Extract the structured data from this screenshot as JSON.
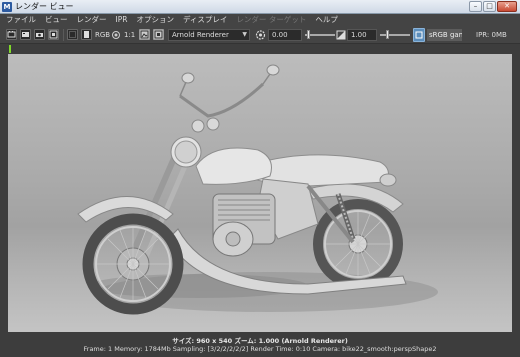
{
  "window": {
    "icon_letter": "M",
    "title": "レンダー ビュー",
    "buttons": {
      "minimize": "–",
      "maximize": "□",
      "close": "✕"
    }
  },
  "menu": [
    {
      "label": "ファイル",
      "enabled": true
    },
    {
      "label": "ビュー",
      "enabled": true
    },
    {
      "label": "レンダー",
      "enabled": true
    },
    {
      "label": "IPR",
      "enabled": true
    },
    {
      "label": "オプション",
      "enabled": true
    },
    {
      "label": "ディスプレイ",
      "enabled": true
    },
    {
      "label": "レンダー ターゲット",
      "enabled": false
    },
    {
      "label": "ヘルプ",
      "enabled": true
    }
  ],
  "toolbar": {
    "rgb_label": "RGB",
    "ratio_label": "1:1",
    "renderer": "Arnold Renderer",
    "exposure_value": "0.00",
    "gamma_value": "1.00",
    "color_space": "sRGB gamma",
    "ipr_status": "IPR: 0MB",
    "icons": [
      "render-icon",
      "ipr-icon",
      "snapshot-icon",
      "refresh-icon",
      "region-icon",
      "keep-image-icon",
      "remove-image-icon",
      "rgb-channel-icon",
      "alpha-icon",
      "real-size-icon",
      "snapshot-view-icon",
      "image-plane-icon",
      "exposure-icon",
      "gamma-icon",
      "color-manage-icon"
    ]
  },
  "viewport": {
    "subject": "motorcycle render",
    "background_top": "#bcbcbc",
    "background_mid": "#a2a2a2"
  },
  "render_info": {
    "line1": "サイズ: 960 x 540 ズーム: 1.000    (Arnold Renderer)",
    "line2": "Frame: 1    Memory: 1784Mb    Sampling: [3/2/2/2/2/2]    Render Time: 0:10    Camera: bike22_smooth:perspShape2"
  },
  "colors": {
    "app_bg": "#444444",
    "accent": "#5d8fbd",
    "progress": "#7fd82a"
  }
}
